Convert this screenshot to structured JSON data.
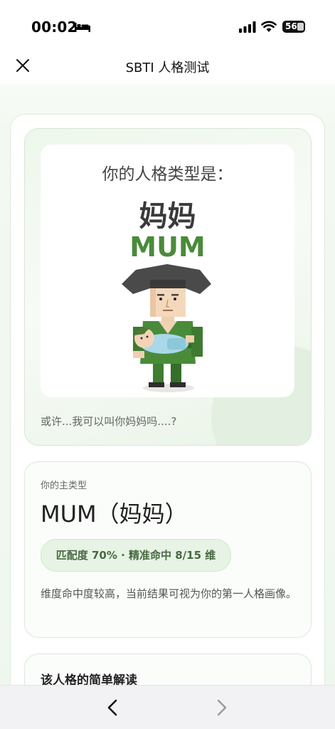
{
  "status_bar": {
    "time": "00:02",
    "battery": "56",
    "icons": [
      "bed-icon",
      "cellular-signal-icon",
      "wifi-icon",
      "battery-icon"
    ]
  },
  "nav": {
    "title": "SBTI 人格测试",
    "close_icon": "close-icon"
  },
  "result": {
    "label": "你的人格类型是：",
    "type_cn": "妈妈",
    "type_en": "MUM",
    "caption": "或许...我可以叫你妈妈吗....?",
    "illustration": "character holding a baby",
    "accent_color": "#4a8b3a"
  },
  "main_type": {
    "label": "你的主类型",
    "value": "MUM（妈妈）",
    "match": "匹配度 70% · 精准命中 8/15 维",
    "description": "维度命中度较高，当前结果可视为你的第一人格画像。"
  },
  "interpretation": {
    "title": "该人格的简单解读"
  },
  "toolbar": {
    "back_icon": "chevron-left-icon",
    "forward_icon": "chevron-right-icon"
  }
}
